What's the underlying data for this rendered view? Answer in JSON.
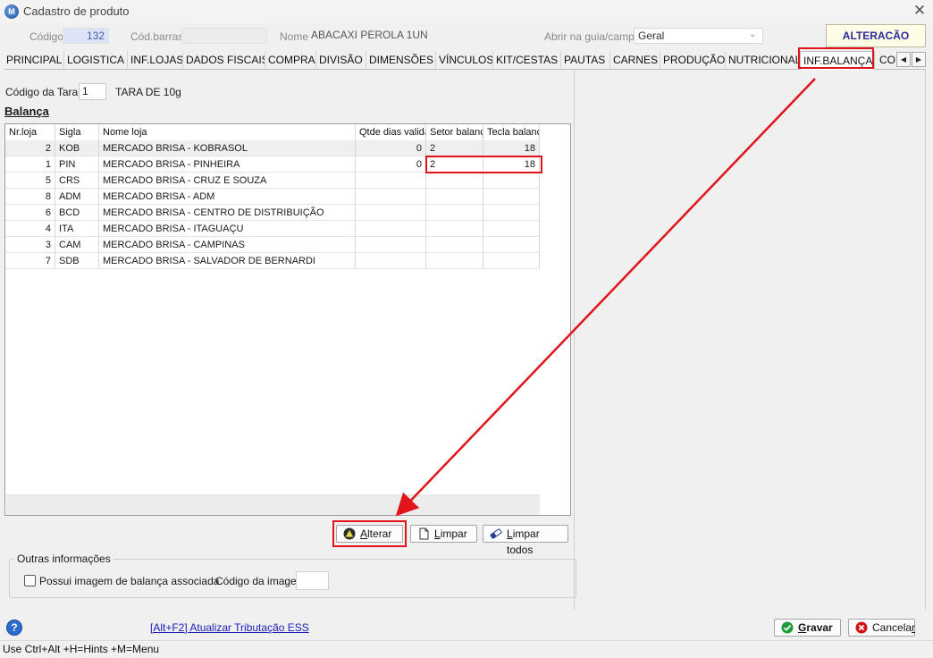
{
  "window": {
    "title": "Cadastro de produto",
    "app_icon": "M"
  },
  "header": {
    "codigo_label": "Código",
    "codigo_value": "132",
    "barras_label": "Cód.barras",
    "barras_value": "",
    "nome_label": "Nome",
    "nome_value": "ABACAXI PEROLA 1UN",
    "guia_label": "Abrir na guia/campo",
    "guia_value": "Geral",
    "status": "ALTERACÃO"
  },
  "tabs": [
    {
      "label": "PRINCIPAL"
    },
    {
      "label": "LOGISTICA"
    },
    {
      "label": "INF.LOJAS"
    },
    {
      "label": "DADOS FISCAIS"
    },
    {
      "label": "COMPRA"
    },
    {
      "label": "DIVISÃO"
    },
    {
      "label": "DIMENSÕES"
    },
    {
      "label": "VÍNCULOS"
    },
    {
      "label": "KIT/CESTAS"
    },
    {
      "label": "PAUTAS"
    },
    {
      "label": "CARNES"
    },
    {
      "label": "PRODUÇÃO"
    },
    {
      "label": "NUTRICIONAL"
    },
    {
      "label": "INF.BALANÇA"
    },
    {
      "label": "CON"
    }
  ],
  "active_tab": "INF.BALANÇA",
  "tara": {
    "label": "Código da Tara:",
    "value": "1",
    "description": "TARA DE 10g"
  },
  "balanca_heading": "Balança",
  "grid": {
    "columns": [
      "Nr.loja",
      "Sigla",
      "Nome loja",
      "Qtde dias validade",
      "Setor balança",
      "Tecla balança"
    ],
    "rows": [
      {
        "nr": "2",
        "sigla": "KOB",
        "nome": "MERCADO BRISA - KOBRASOL",
        "dias": "0",
        "setor": "2",
        "tecla": "18"
      },
      {
        "nr": "1",
        "sigla": "PIN",
        "nome": "MERCADO BRISA - PINHEIRA",
        "dias": "0",
        "setor": "2",
        "tecla": "18"
      },
      {
        "nr": "5",
        "sigla": "CRS",
        "nome": "MERCADO BRISA - CRUZ E SOUZA",
        "dias": "",
        "setor": "",
        "tecla": ""
      },
      {
        "nr": "8",
        "sigla": "ADM",
        "nome": "MERCADO BRISA - ADM",
        "dias": "",
        "setor": "",
        "tecla": ""
      },
      {
        "nr": "6",
        "sigla": "BCD",
        "nome": "MERCADO BRISA -  CENTRO DE DISTRIBUIÇÃO",
        "dias": "",
        "setor": "",
        "tecla": ""
      },
      {
        "nr": "4",
        "sigla": "ITA",
        "nome": "MERCADO BRISA - ITAGUAÇU",
        "dias": "",
        "setor": "",
        "tecla": ""
      },
      {
        "nr": "3",
        "sigla": "CAM",
        "nome": "MERCADO BRISA - CAMPINAS",
        "dias": "",
        "setor": "",
        "tecla": ""
      },
      {
        "nr": "7",
        "sigla": "SDB",
        "nome": "MERCADO BRISA - SALVADOR DE BERNARDI",
        "dias": "",
        "setor": "",
        "tecla": ""
      }
    ]
  },
  "buttons": {
    "alterar_first": "A",
    "alterar_rest": "lterar",
    "limpar_first": "L",
    "limpar_rest": "impar",
    "limpar_todos_first": "L",
    "limpar_todos_rest": "impar todos",
    "gravar_first": "G",
    "gravar_rest": "ravar",
    "cancelar_first": "Cancela",
    "cancelar_rest": "r"
  },
  "outras": {
    "legend": "Outras informações",
    "checkbox_label": "Possui imagem de balança associada",
    "checked": false,
    "codigo_imagem_label": "Código da imagem",
    "codigo_imagem_value": ""
  },
  "footer": {
    "help": "?",
    "ess_link": "[Alt+F2] Atualizar Tributação ESS",
    "statusbar": "Use Ctrl+Alt +H=Hints +M=Menu"
  },
  "colors": {
    "annotation": "#e0141a",
    "link": "#1b1bb8",
    "status_text": "#2b2b9c"
  }
}
